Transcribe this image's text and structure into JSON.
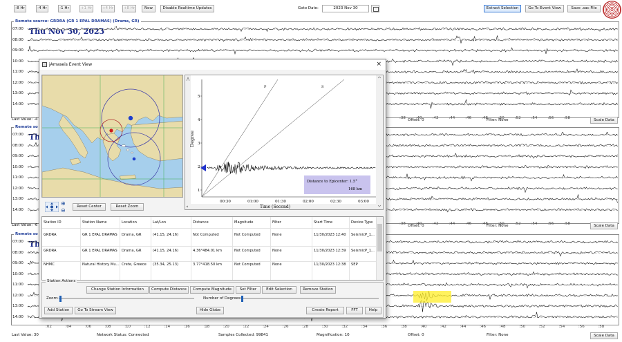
{
  "toolbar": {
    "buttons": [
      "-8 Hr",
      "-4 Hr",
      "-1 Hr",
      "+1 Hr",
      "+4 Hr",
      "+8 Hr",
      "Now",
      "Disable Realtime Updates"
    ],
    "goto_label": "Goto Date:",
    "goto_value": "2023 Nov 30",
    "extract_selection": "Extract Selection",
    "go_to_event_view": "Go To Event View",
    "save_sac": "Save .sac File"
  },
  "panels": [
    {
      "title": "Remote source: GRDRA (GR 1 EPAL DRAMAS) (Drama, GR)",
      "date_text": "Thu Nov 30, 2023",
      "hours": [
        "07:00",
        "08:00",
        "09:00",
        "10:00",
        "11:00",
        "12:00",
        "13:00",
        "14:00"
      ],
      "last_value": "Last Value: -4",
      "offset": "Offset: 0",
      "filter": "Filter: None",
      "scale": "Scale Data"
    },
    {
      "title": "Remote so",
      "date_text": "Th",
      "hours": [
        "07:00",
        "08:00",
        "09:00",
        "10:00",
        "11:00",
        "12:00",
        "13:00",
        "14:00"
      ],
      "last_value": "Last Value: -6",
      "offset": "Offset: 0",
      "filter": "Filter: None",
      "scale": "Scale Data"
    },
    {
      "title": "Remote so",
      "date_text": "Th",
      "hours": [
        "07:00",
        "08:00",
        "09:00",
        "10:00",
        "11:00",
        "12:00",
        "13:00",
        "14:00"
      ],
      "last_value": "Last Value: 30",
      "offset": "Offset: 0",
      "filter": "Filter: None",
      "scale": "Scale Data"
    }
  ],
  "right_ticks": [
    ":38",
    ":40",
    ":42",
    ":44",
    ":46",
    ":48",
    ":50",
    ":52",
    ":54",
    ":56",
    ":58"
  ],
  "bottom_ticks": [
    ":02",
    ":04",
    ":06",
    ":08",
    ":10",
    ":12",
    ":14",
    ":16",
    ":18",
    ":20",
    ":22",
    ":24",
    ":26",
    ":28",
    ":30",
    ":32",
    ":34",
    ":36",
    ":38",
    ":40",
    ":42",
    ":44",
    ":46",
    ":48",
    ":50",
    ":52",
    ":54",
    ":56",
    ":58"
  ],
  "status": {
    "network": "Network Status: Connected",
    "samples": "Samples Collected: 99841",
    "magnification": "Magnification: 10"
  },
  "dialog": {
    "title": "jAmaseis Event View",
    "reset_center": "Reset Center",
    "reset_zoom": "Reset Zoom",
    "plot": {
      "y_label": "Degree",
      "x_label": "Time (Second)",
      "y_ticks": [
        "5",
        "4",
        "3",
        "2",
        "1"
      ],
      "x_ticks": [
        "00:30",
        "01:00",
        "01:30",
        "02:00",
        "02:30",
        "03:00"
      ],
      "line_labels": [
        "P",
        "S"
      ],
      "info_line1": "Distance to Epicenter: 1.5°",
      "info_line2": "168 km"
    },
    "table": {
      "headers": [
        "Station ID",
        "Station Name",
        "Location",
        "Lat/Lon",
        "Distance",
        "Magnitude",
        "Filter",
        "Start Time",
        "Device Type"
      ],
      "rows": [
        [
          "GRDRA",
          "GR 1 EPAL DRAMAS",
          "Drama, GR",
          "(41.15, 24.16)",
          "Not Computed",
          "Not Computed",
          "None",
          "11/30/2023 12:40",
          "SeismicP_1..."
        ],
        [
          "GRDRA",
          "GR 1 EPAL DRAMAS",
          "Drama, GR",
          "(41.15, 24.16)",
          "4.36°484.01 km",
          "Not Computed",
          "None",
          "11/30/2023 12:39",
          "SeismicP_1..."
        ],
        [
          "NHMC",
          "Natural History Mu...",
          "Crete, Greece",
          "(35.34, 25.13)",
          "3.77°418.50 km",
          "Not Computed",
          "None",
          "11/30/2023 12:38",
          "SEP"
        ]
      ]
    },
    "actions": {
      "group_title": "Station Actions",
      "change_station": "Change Station Information",
      "compute_distance": "Compute Distance",
      "compute_magnitude": "Compute Magnitude",
      "set_filter": "Set Filter",
      "edit_selection": "Edit Selection",
      "remove_station": "Remove Station",
      "zoom_label": "Zoom:",
      "degrees_label": "Number of Degrees:",
      "add_station": "Add Station",
      "go_to_stream": "Go To Stream View",
      "hide_globe": "Hide Globe",
      "create_report": "Create Report",
      "fft": "FFT",
      "help": "Help"
    }
  }
}
